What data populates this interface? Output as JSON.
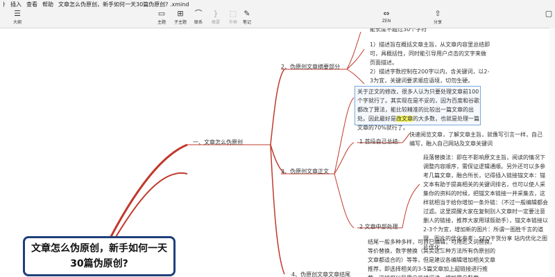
{
  "menu": {
    "left_item": "ㅏ",
    "insert": "插入",
    "view": "查看",
    "help": "帮助",
    "title": "文章怎么伪原创，新手如何一天30篇伪原创? .xmind"
  },
  "toolbar": {
    "outline": "大纲",
    "topic": "主题",
    "subtopic": "子主题",
    "relation": "联系",
    "frame": "概要",
    "boundary": "外框",
    "notes": "笔记",
    "zen": "ZEN",
    "share": "分享"
  },
  "map": {
    "top_cut": "能长度不超过30个字符",
    "node1": "一、文章怎么伪原创",
    "node2": "2、伪原创文章摘要部分",
    "node3": "3、伪原创文章正文",
    "node4_cut": "4、伪原创文章文章结尾",
    "summary1": "1）描述旨在概括文章主旨，从文章内容里总结即可，具概括性，同时能引导用户点击的文字来做页面描述。",
    "summary2": "2）描述字数控制在200字以内，含关键词，以2-3为宜，关键词要求顺应语境，切勿生硬。",
    "selected_a": "关于正文的修改，很多人认为只要处理文章前100个字就行了。其实现在是不妥的，因为百度和谷歌都改了算法，能比较精准的比较出一篇文章的出处。因此最好是",
    "selected_hl": "改文章",
    "selected_b": "的大多数，也就是处理一篇文章的70%就行了。",
    "step1": "1 首段自己总结:",
    "step1_text": "快速阅览文章，了解文章主旨，就像写引言一样，自己编写，融入自己网站及文章关键词",
    "step2": "2 文章中部处理",
    "step2_text": "段落替换法：即在不影响原文主旨，阅读的情况下调整内容顺序，需保证逻辑通顺。另外还可以多参考几篇文章，融合所长，记得插入链接锚文本：锚文本有助于提高相关的关键词排名，也可以使人采集你的资料的时候，把锚文本链接一并采集去，这样就相当于给你增加一条外链：（不过一般编辑都会过滤。这里提醒大家在复制别人文章时一定要注意删人的链接，推荐大家用球版助手），锚文本链接以2-3个为宜，增加新的图片：所谓一图胜千言的道理。图片的优化参考：SEO干货分享 站内优化之图片优化。",
    "ending_text": "结尾一般多种多样，可自己编辑，可用近义词替换，等价替换，数字替换（其实这三种方法所有伪原创的文章都适合的）等等，但是建议各编辑增加相关文章推荐，即选择相关的3-5篇文章加上超链接进行推荐，这样可以导用户继续阅读，增加用户黏度。",
    "root": "文章怎么伪原创，新手如何一天30篇伪原创?"
  }
}
